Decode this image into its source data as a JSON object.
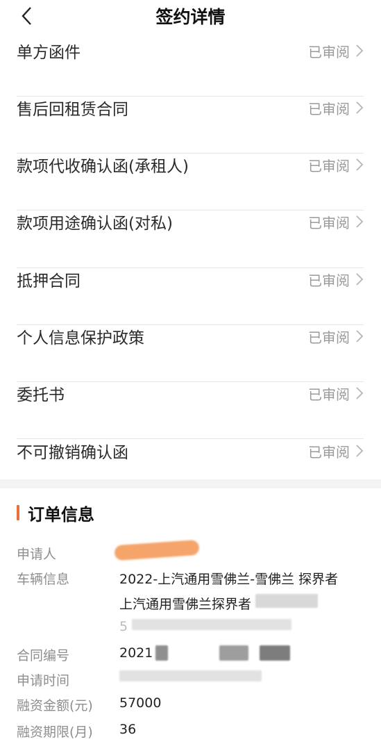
{
  "header": {
    "title": "签约详情"
  },
  "documents": [
    {
      "label": "单方函件",
      "status": "已审阅"
    },
    {
      "label": "售后回租赁合同",
      "status": "已审阅"
    },
    {
      "label": "款项代收确认函(承租人)",
      "status": "已审阅"
    },
    {
      "label": "款项用途确认函(对私)",
      "status": "已审阅"
    },
    {
      "label": "抵押合同",
      "status": "已审阅"
    },
    {
      "label": "个人信息保护政策",
      "status": "已审阅"
    },
    {
      "label": "委托书",
      "status": "已审阅"
    },
    {
      "label": "不可撤销确认函",
      "status": "已审阅"
    }
  ],
  "order": {
    "title": "订单信息",
    "applicant_label": "申请人",
    "vehicle_label": "车辆信息",
    "vehicle_line1": "2022-上汽通用雪佛兰-雪佛兰 探界者",
    "vehicle_line2": "上汽通用雪佛兰探界者",
    "vehicle_line3": "5",
    "contract_label": "合同编号",
    "contract_value": "2021",
    "time_label": "申请时间",
    "amount_label": "融资金额(元)",
    "amount_value": "57000",
    "term_label": "融资期限(月)",
    "term_value": "36"
  },
  "colors": {
    "accent": "#e8703a",
    "status_gray": "#9a9a9a"
  }
}
